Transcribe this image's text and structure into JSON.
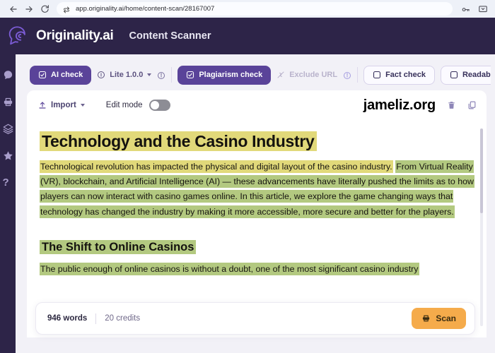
{
  "browser": {
    "back_icon": "arrow-left-icon",
    "forward_icon": "arrow-right-icon",
    "reload_icon": "reload-icon",
    "site_icon": "site-settings-icon",
    "url": "app.originality.ai/home/content-scan/28167007",
    "right_icons": [
      "key-icon",
      "cast-icon"
    ]
  },
  "header": {
    "logo": "originality-brain-logo",
    "brand": "Originality.ai",
    "title": "Content Scanner",
    "bg_color": "#2d2448"
  },
  "sidebar": {
    "items": [
      {
        "name": "chat-icon",
        "label": "Chat"
      },
      {
        "name": "scan-icon",
        "label": "Scan"
      },
      {
        "name": "layers-icon",
        "label": "Layers"
      },
      {
        "name": "star-icon",
        "label": "Favorites"
      },
      {
        "name": "help-icon",
        "label": "?"
      }
    ]
  },
  "toolbar": {
    "ai_check": "AI check",
    "model": "Lite 1.0.0",
    "model_info_icon": "info-icon",
    "plagiarism_check": "Plagiarism check",
    "exclude_url": "Exclude URL",
    "exclude_info_icon": "info-icon",
    "fact_check": "Fact check",
    "readability": "Readabi",
    "accent_color": "#5a4399"
  },
  "editor": {
    "import_label": "Import",
    "import_icon": "upload-icon",
    "import_caret": "chevron-down-icon",
    "edit_mode_label": "Edit mode",
    "edit_mode_on": false,
    "watermark": "jameliz.org",
    "delete_icon": "trash-icon",
    "copy_icon": "copy-icon"
  },
  "article": {
    "heading1": "Technology and the Casino Industry",
    "p1_yellow": "Technological revolution has impacted the physical and digital layout of the casino industry.",
    "p1_green": "From Virtual Reality (VR), blockchain, and Artificial Intelligence (AI) — these advancements have literally pushed the limits as to how players can now interact with casino games online.  In this article, we explore the game changing ways that technology has changed the industry by making it more accessible, more secure and better for the players.",
    "heading2": "The Shift to Online Casinos",
    "p2_green": "The public enough of online casinos is without a doubt, one of the most significant casino industry",
    "highlight_yellow": "#e1d97a",
    "highlight_green": "#b3c980"
  },
  "status": {
    "words": "946 words",
    "credits": "20 credits",
    "scan_label": "Scan",
    "scan_icon": "scan-document-icon",
    "scan_color": "#f5ab4b"
  }
}
